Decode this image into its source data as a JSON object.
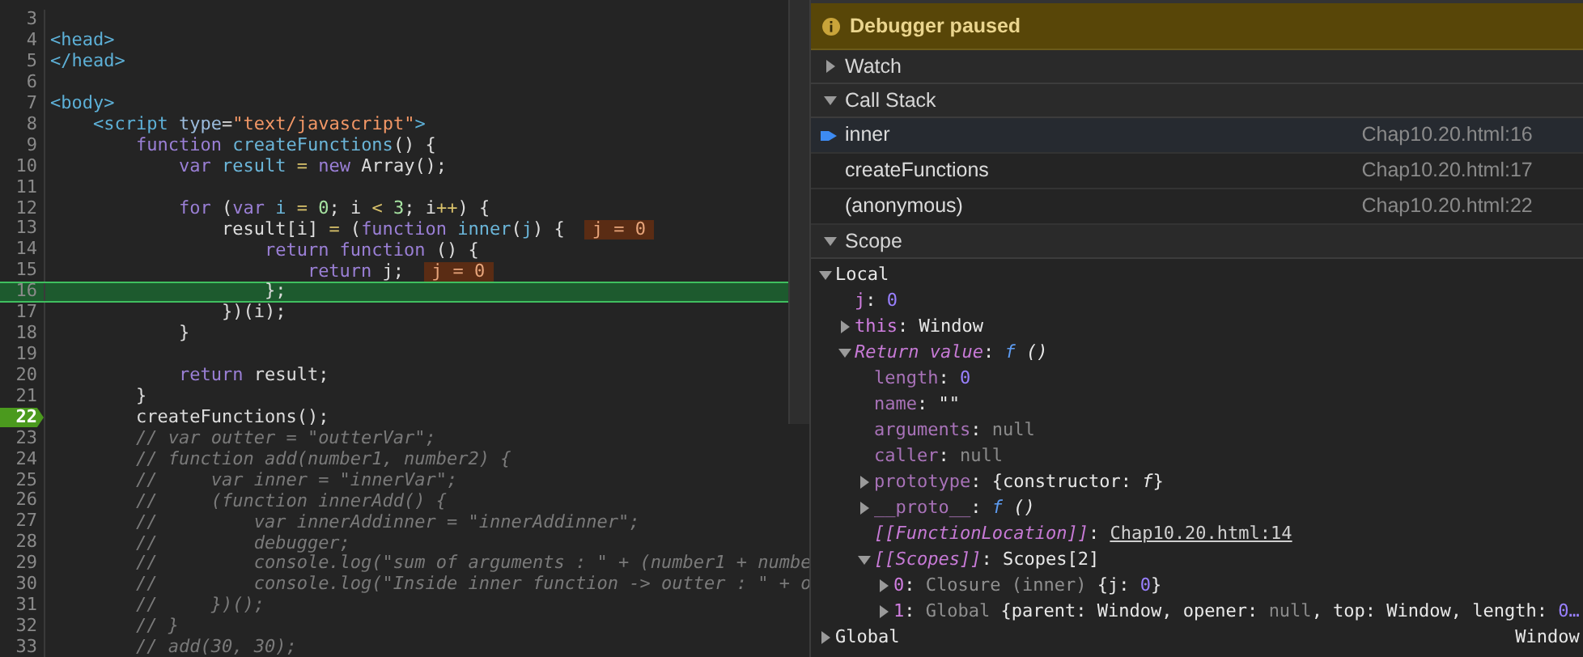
{
  "editor": {
    "lines": [
      {
        "number": "3",
        "highlighted": false,
        "breakpoint": false
      },
      {
        "number": "4",
        "tokens": [
          {
            "text": "<head>",
            "kind": "tag"
          }
        ],
        "highlighted": false,
        "breakpoint": false
      },
      {
        "number": "5",
        "tokens": [
          {
            "text": "</head>",
            "kind": "tag"
          }
        ],
        "highlighted": false,
        "breakpoint": false
      },
      {
        "number": "6",
        "highlighted": false,
        "breakpoint": false
      },
      {
        "number": "7",
        "tokens": [
          {
            "text": "<body>",
            "kind": "tag"
          }
        ],
        "highlighted": false,
        "breakpoint": false
      },
      {
        "number": "8",
        "tokens": [
          {
            "text": "    <script ",
            "kind": "tag"
          },
          {
            "text": "type",
            "kind": "attr"
          },
          {
            "text": "=",
            "kind": "plain"
          },
          {
            "text": "\"text/javascript\"",
            "kind": "string"
          },
          {
            "text": ">",
            "kind": "tag"
          }
        ],
        "highlighted": false,
        "breakpoint": false
      },
      {
        "number": "9",
        "tokens": [
          {
            "text": "        function ",
            "kind": "keyword"
          },
          {
            "text": "createFunctions",
            "kind": "def"
          },
          {
            "text": "() {",
            "kind": "plain"
          }
        ],
        "highlighted": false,
        "breakpoint": false
      },
      {
        "number": "10",
        "tokens": [
          {
            "text": "            var ",
            "kind": "keyword"
          },
          {
            "text": "result ",
            "kind": "def"
          },
          {
            "text": "= ",
            "kind": "operator"
          },
          {
            "text": "new",
            "kind": "keyword"
          },
          {
            "text": " Array();",
            "kind": "plain"
          }
        ],
        "highlighted": false,
        "breakpoint": false
      },
      {
        "number": "11",
        "highlighted": false,
        "breakpoint": false
      },
      {
        "number": "12",
        "tokens": [
          {
            "text": "            for",
            "kind": "keyword"
          },
          {
            "text": " (",
            "kind": "plain"
          },
          {
            "text": "var ",
            "kind": "keyword"
          },
          {
            "text": "i ",
            "kind": "def"
          },
          {
            "text": "= ",
            "kind": "operator"
          },
          {
            "text": "0",
            "kind": "number"
          },
          {
            "text": "; i ",
            "kind": "plain"
          },
          {
            "text": "< ",
            "kind": "operator"
          },
          {
            "text": "3",
            "kind": "number"
          },
          {
            "text": "; i",
            "kind": "plain"
          },
          {
            "text": "++",
            "kind": "operator"
          },
          {
            "text": ") {",
            "kind": "plain"
          }
        ],
        "highlighted": false,
        "breakpoint": false
      },
      {
        "number": "13",
        "tokens": [
          {
            "text": "                result[i] ",
            "kind": "plain"
          },
          {
            "text": "=",
            "kind": "operator"
          },
          {
            "text": " (",
            "kind": "plain"
          },
          {
            "text": "function ",
            "kind": "keyword"
          },
          {
            "text": "inner",
            "kind": "def"
          },
          {
            "text": "(",
            "kind": "plain"
          },
          {
            "text": "j",
            "kind": "def"
          },
          {
            "text": ") {",
            "kind": "plain"
          }
        ],
        "inline_value": "j = 0",
        "highlighted": false,
        "breakpoint": false
      },
      {
        "number": "14",
        "tokens": [
          {
            "text": "                    return function",
            "kind": "keyword"
          },
          {
            "text": " () {",
            "kind": "plain"
          }
        ],
        "highlighted": false,
        "breakpoint": false
      },
      {
        "number": "15",
        "tokens": [
          {
            "text": "                        return",
            "kind": "keyword"
          },
          {
            "text": " j;",
            "kind": "plain"
          }
        ],
        "inline_value": "j = 0",
        "highlighted": false,
        "breakpoint": false
      },
      {
        "number": "16",
        "tokens": [
          {
            "text": "                    };",
            "kind": "plain"
          }
        ],
        "highlighted": true,
        "breakpoint": false
      },
      {
        "number": "17",
        "tokens": [
          {
            "text": "                })(i);",
            "kind": "plain"
          }
        ],
        "highlighted": false,
        "breakpoint": false
      },
      {
        "number": "18",
        "tokens": [
          {
            "text": "            }",
            "kind": "plain"
          }
        ],
        "highlighted": false,
        "breakpoint": false
      },
      {
        "number": "19",
        "highlighted": false,
        "breakpoint": false
      },
      {
        "number": "20",
        "tokens": [
          {
            "text": "            return",
            "kind": "keyword"
          },
          {
            "text": " result;",
            "kind": "plain"
          }
        ],
        "highlighted": false,
        "breakpoint": false
      },
      {
        "number": "21",
        "tokens": [
          {
            "text": "        }",
            "kind": "plain"
          }
        ],
        "highlighted": false,
        "breakpoint": false
      },
      {
        "number": "22",
        "tokens": [
          {
            "text": "        createFunctions();",
            "kind": "plain"
          }
        ],
        "highlighted": false,
        "breakpoint": true
      },
      {
        "number": "23",
        "tokens": [
          {
            "text": "        // var outter = \"outterVar\";",
            "kind": "comment"
          }
        ],
        "highlighted": false,
        "breakpoint": false
      },
      {
        "number": "24",
        "tokens": [
          {
            "text": "        // function add(number1, number2) {",
            "kind": "comment"
          }
        ],
        "highlighted": false,
        "breakpoint": false
      },
      {
        "number": "25",
        "tokens": [
          {
            "text": "        //     var inner = \"innerVar\";",
            "kind": "comment"
          }
        ],
        "highlighted": false,
        "breakpoint": false
      },
      {
        "number": "26",
        "tokens": [
          {
            "text": "        //     (function innerAdd() {",
            "kind": "comment"
          }
        ],
        "highlighted": false,
        "breakpoint": false
      },
      {
        "number": "27",
        "tokens": [
          {
            "text": "        //         var innerAddinner = \"innerAddinner\";",
            "kind": "comment"
          }
        ],
        "highlighted": false,
        "breakpoint": false
      },
      {
        "number": "28",
        "tokens": [
          {
            "text": "        //         debugger;",
            "kind": "comment"
          }
        ],
        "highlighted": false,
        "breakpoint": false
      },
      {
        "number": "29",
        "tokens": [
          {
            "text": "        //         console.log(\"sum of arguments : \" + (number1 + numbe",
            "kind": "comment"
          }
        ],
        "highlighted": false,
        "breakpoint": false
      },
      {
        "number": "30",
        "tokens": [
          {
            "text": "        //         console.log(\"Inside inner function -> outter : \" + o",
            "kind": "comment"
          }
        ],
        "highlighted": false,
        "breakpoint": false
      },
      {
        "number": "31",
        "tokens": [
          {
            "text": "        //     })();",
            "kind": "comment"
          }
        ],
        "highlighted": false,
        "breakpoint": false
      },
      {
        "number": "32",
        "tokens": [
          {
            "text": "        // }",
            "kind": "comment"
          }
        ],
        "highlighted": false,
        "breakpoint": false
      },
      {
        "number": "33",
        "tokens": [
          {
            "text": "        // add(30, 30);",
            "kind": "comment"
          }
        ],
        "highlighted": false,
        "breakpoint": false
      }
    ]
  },
  "debugger": {
    "banner": "Debugger paused",
    "watch": {
      "title": "Watch",
      "expanded": false
    },
    "call_stack": {
      "title": "Call Stack",
      "expanded": true,
      "frames": [
        {
          "name": "inner",
          "location": "Chap10.20.html:16",
          "selected": true
        },
        {
          "name": "createFunctions",
          "location": "Chap10.20.html:17",
          "selected": false
        },
        {
          "name": "(anonymous)",
          "location": "Chap10.20.html:22",
          "selected": false
        }
      ]
    },
    "scope": {
      "title": "Scope",
      "expanded": true,
      "tree": [
        {
          "label": "Local",
          "kind": "scope",
          "expanded": true,
          "children": [
            {
              "label": "j",
              "kind": "own",
              "value": [
                {
                  "text": ": ",
                  "kind": "plain"
                },
                {
                  "text": "0",
                  "kind": "number"
                }
              ]
            },
            {
              "label": "this",
              "kind": "own",
              "expanded": false,
              "value": [
                {
                  "text": ": Window",
                  "kind": "plain"
                }
              ]
            },
            {
              "label": "Return value",
              "kind": "special",
              "expanded": true,
              "value": [
                {
                  "text": ": ",
                  "kind": "plain"
                },
                {
                  "text": "f",
                  "kind": "func"
                },
                {
                  "text": " ()",
                  "kind": "italic"
                }
              ],
              "children": [
                {
                  "label": "length",
                  "kind": "dim",
                  "value": [
                    {
                      "text": ": ",
                      "kind": "plain"
                    },
                    {
                      "text": "0",
                      "kind": "number"
                    }
                  ]
                },
                {
                  "label": "name",
                  "kind": "dim",
                  "value": [
                    {
                      "text": ": \"\"",
                      "kind": "plain"
                    }
                  ]
                },
                {
                  "label": "arguments",
                  "kind": "dim",
                  "value": [
                    {
                      "text": ": ",
                      "kind": "plain"
                    },
                    {
                      "text": "null",
                      "kind": "null"
                    }
                  ]
                },
                {
                  "label": "caller",
                  "kind": "dim",
                  "value": [
                    {
                      "text": ": ",
                      "kind": "plain"
                    },
                    {
                      "text": "null",
                      "kind": "null"
                    }
                  ]
                },
                {
                  "label": "prototype",
                  "kind": "dim",
                  "expanded": false,
                  "value": [
                    {
                      "text": ": {constructor: ",
                      "kind": "plain"
                    },
                    {
                      "text": "f",
                      "kind": "italic"
                    },
                    {
                      "text": "}",
                      "kind": "plain"
                    }
                  ]
                },
                {
                  "label": "__proto__",
                  "kind": "dim",
                  "expanded": false,
                  "value": [
                    {
                      "text": ": ",
                      "kind": "plain"
                    },
                    {
                      "text": "f",
                      "kind": "func"
                    },
                    {
                      "text": " ()",
                      "kind": "italic"
                    }
                  ]
                },
                {
                  "label": "[[FunctionLocation]]",
                  "kind": "special",
                  "value": [
                    {
                      "text": ": ",
                      "kind": "plain"
                    },
                    {
                      "text": "Chap10.20.html:14",
                      "kind": "link"
                    }
                  ]
                },
                {
                  "label": "[[Scopes]]",
                  "kind": "special",
                  "expanded": true,
                  "value": [
                    {
                      "text": ": Scopes[2]",
                      "kind": "plain"
                    }
                  ],
                  "children": [
                    {
                      "label": "0",
                      "kind": "own",
                      "expanded": false,
                      "value": [
                        {
                          "text": ": ",
                          "kind": "plain"
                        },
                        {
                          "text": "Closure (inner) ",
                          "kind": "dim"
                        },
                        {
                          "text": "{j: ",
                          "kind": "plain"
                        },
                        {
                          "text": "0",
                          "kind": "number"
                        },
                        {
                          "text": "}",
                          "kind": "plain"
                        }
                      ]
                    },
                    {
                      "label": "1",
                      "kind": "own",
                      "expanded": false,
                      "value": [
                        {
                          "text": ": ",
                          "kind": "plain"
                        },
                        {
                          "text": "Global ",
                          "kind": "dim"
                        },
                        {
                          "text": "{parent: Window, opener: ",
                          "kind": "plain"
                        },
                        {
                          "text": "null",
                          "kind": "null"
                        },
                        {
                          "text": ", top: Window, length: ",
                          "kind": "plain"
                        },
                        {
                          "text": "0…",
                          "kind": "number"
                        }
                      ]
                    }
                  ]
                }
              ]
            }
          ]
        },
        {
          "label": "Global",
          "kind": "scope",
          "expanded": false,
          "side_value": "Window"
        }
      ]
    }
  }
}
